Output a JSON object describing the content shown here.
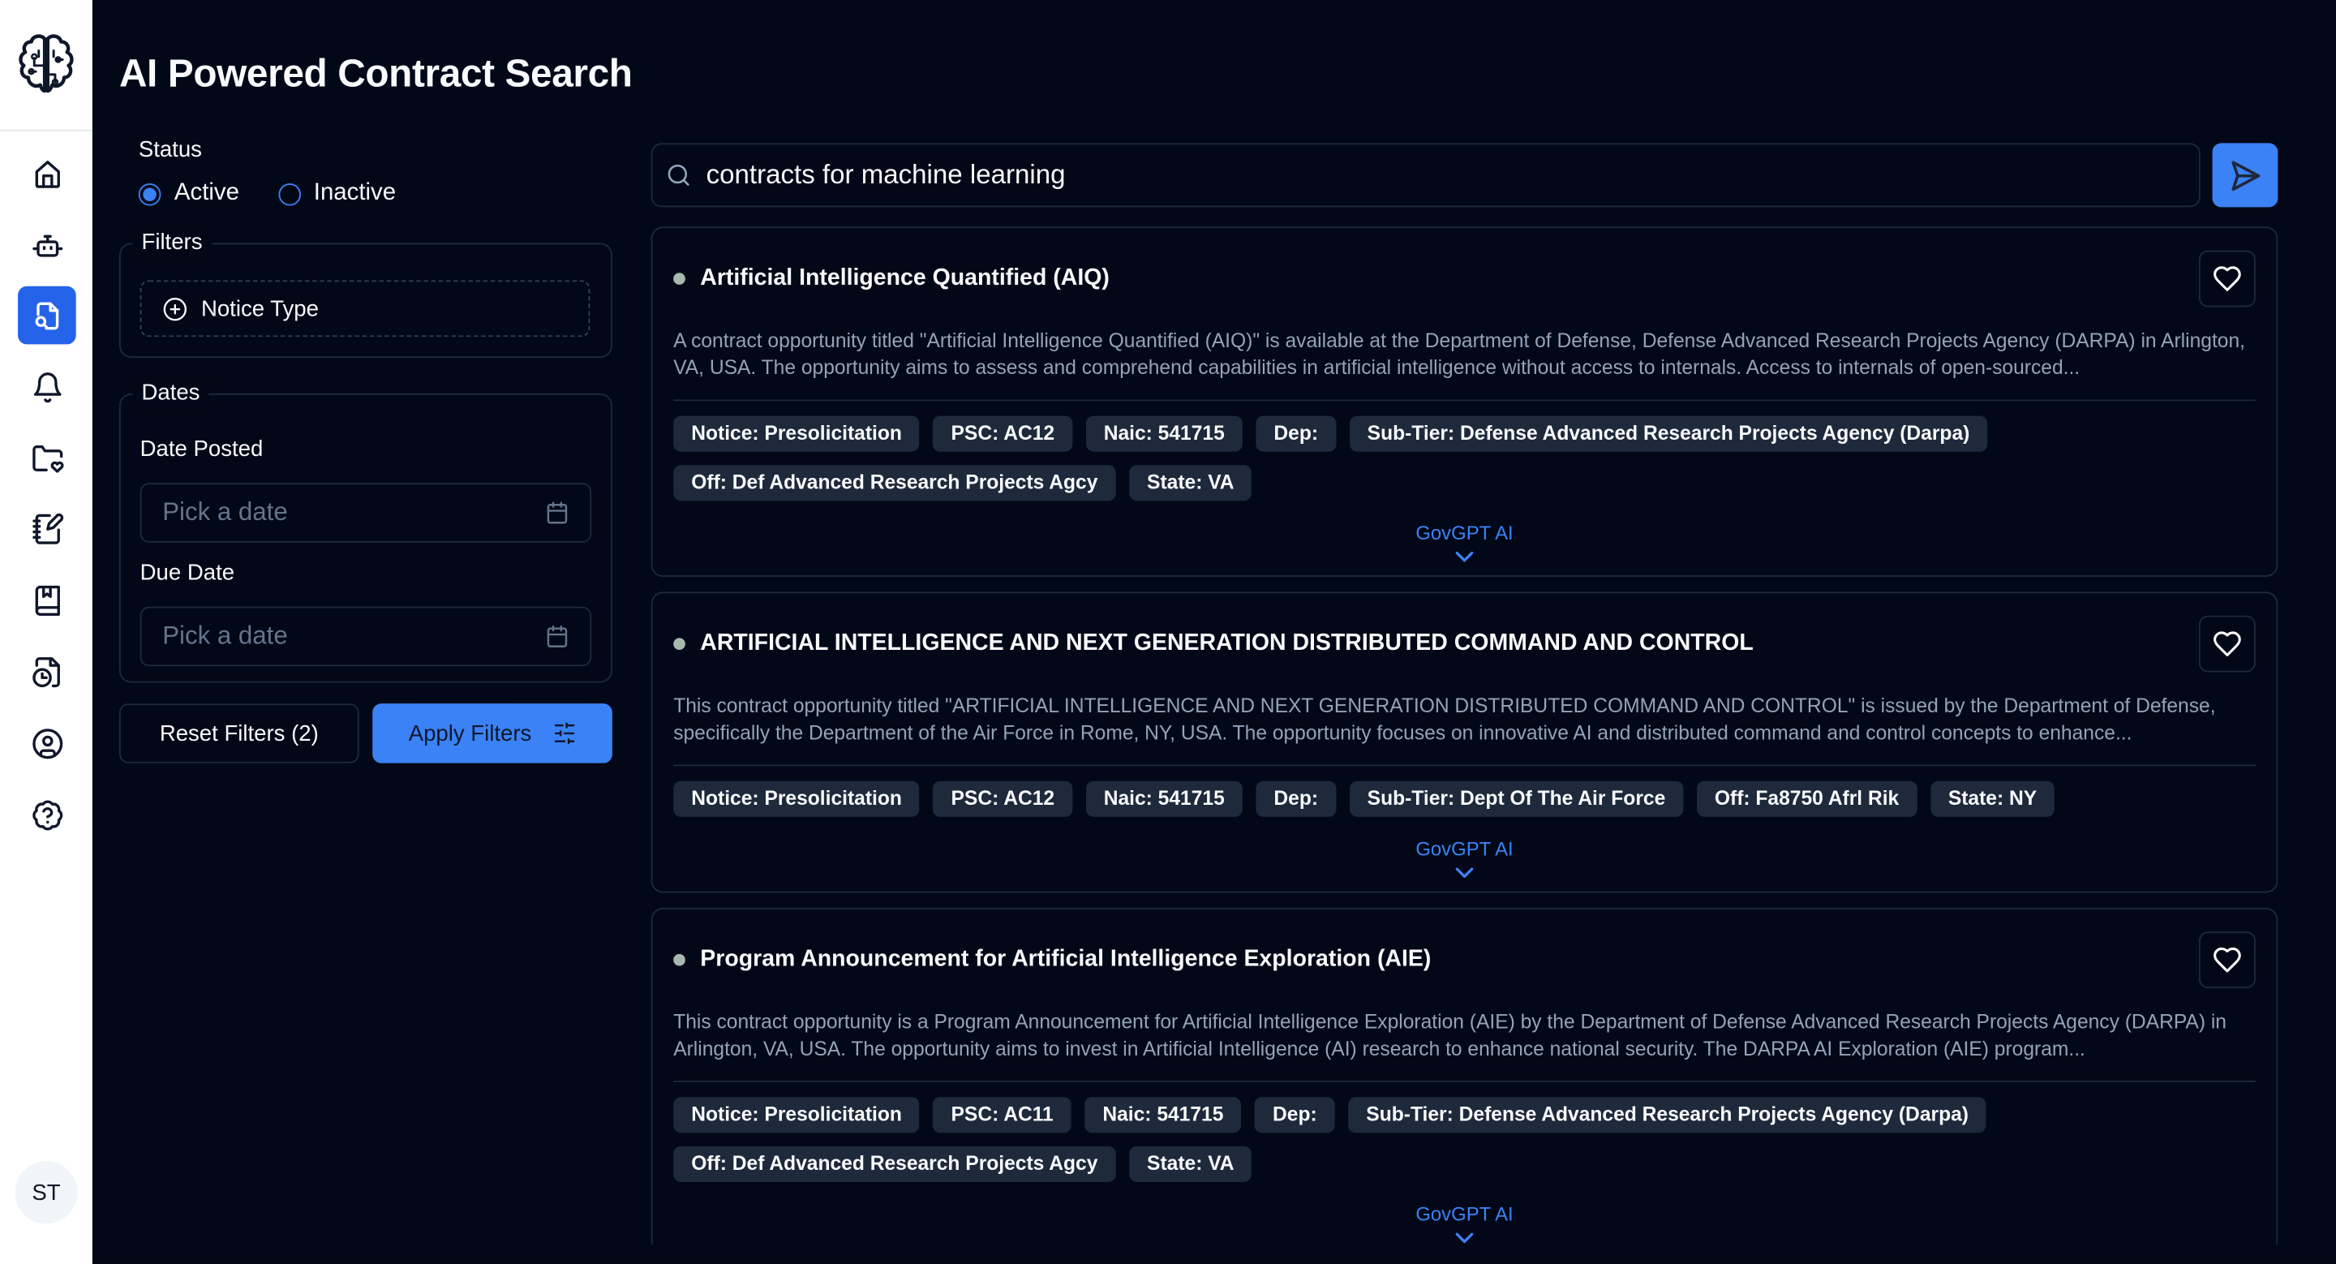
{
  "app": {
    "title": "AI Powered Contract Search",
    "logo_icon": "brain-circuit-icon"
  },
  "sidebar": {
    "items": [
      {
        "name": "home",
        "icon": "home-icon",
        "active": false
      },
      {
        "name": "bot",
        "icon": "bot-icon",
        "active": false
      },
      {
        "name": "contract-search",
        "icon": "file-search-icon",
        "active": true
      },
      {
        "name": "notifications",
        "icon": "bell-icon",
        "active": false
      },
      {
        "name": "saved-folder",
        "icon": "folder-heart-icon",
        "active": false
      },
      {
        "name": "notebook",
        "icon": "notebook-pen-icon",
        "active": false
      },
      {
        "name": "book",
        "icon": "book-bookmark-icon",
        "active": false
      },
      {
        "name": "file-chart",
        "icon": "file-chart-icon",
        "active": false
      },
      {
        "name": "profile",
        "icon": "user-circle-icon",
        "active": false
      },
      {
        "name": "help",
        "icon": "help-badge-icon",
        "active": false
      }
    ],
    "avatar_initials": "ST"
  },
  "filters": {
    "status_label": "Status",
    "status_options": [
      {
        "label": "Active",
        "selected": true
      },
      {
        "label": "Inactive",
        "selected": false
      }
    ],
    "filters_legend": "Filters",
    "notice_type_label": "Notice Type",
    "dates_legend": "Dates",
    "date_posted_label": "Date Posted",
    "date_posted_placeholder": "Pick a date",
    "due_date_label": "Due Date",
    "due_date_placeholder": "Pick a date",
    "reset_label": "Reset Filters (2)",
    "apply_label": "Apply Filters"
  },
  "search": {
    "value": "contracts for machine learning"
  },
  "colors": {
    "background": "#020817",
    "accent": "#3b82f6",
    "active_nav": "#2563eb",
    "tag_bg": "#1e293b",
    "muted_text": "#94a3b8"
  },
  "results": [
    {
      "title": "Artificial Intelligence Quantified (AIQ)",
      "description": "A contract opportunity titled \"Artificial Intelligence Quantified (AIQ)\" is available at the Department of Defense, Defense Advanced Research Projects Agency (DARPA) in Arlington, VA, USA. The opportunity aims to assess and comprehend capabilities in artificial intelligence without access to internals. Access to internals of open-sourced...",
      "tags": [
        "Notice: Presolicitation",
        "PSC: AC12",
        "Naic: 541715",
        "Dep:",
        "Sub-Tier: Defense Advanced Research Projects Agency (Darpa)",
        "Off: Def Advanced Research Projects Agcy",
        "State: VA"
      ],
      "ai_label": "GovGPT AI"
    },
    {
      "title": "ARTIFICIAL INTELLIGENCE AND NEXT GENERATION DISTRIBUTED COMMAND AND CONTROL",
      "description": "This contract opportunity titled \"ARTIFICIAL INTELLIGENCE AND NEXT GENERATION DISTRIBUTED COMMAND AND CONTROL\" is issued by the Department of Defense, specifically the Department of the Air Force in Rome, NY, USA. The opportunity focuses on innovative AI and distributed command and control concepts to enhance...",
      "tags": [
        "Notice: Presolicitation",
        "PSC: AC12",
        "Naic: 541715",
        "Dep:",
        "Sub-Tier: Dept Of The Air Force",
        "Off: Fa8750 Afrl Rik",
        "State: NY"
      ],
      "ai_label": "GovGPT AI"
    },
    {
      "title": "Program Announcement for Artificial Intelligence Exploration (AIE)",
      "description": "This contract opportunity is a Program Announcement for Artificial Intelligence Exploration (AIE) by the Department of Defense Advanced Research Projects Agency (DARPA) in Arlington, VA, USA. The opportunity aims to invest in Artificial Intelligence (AI) research to enhance national security. The DARPA AI Exploration (AIE) program...",
      "tags": [
        "Notice: Presolicitation",
        "PSC: AC11",
        "Naic: 541715",
        "Dep:",
        "Sub-Tier: Defense Advanced Research Projects Agency (Darpa)",
        "Off: Def Advanced Research Projects Agcy",
        "State: VA"
      ],
      "ai_label": "GovGPT AI"
    }
  ]
}
